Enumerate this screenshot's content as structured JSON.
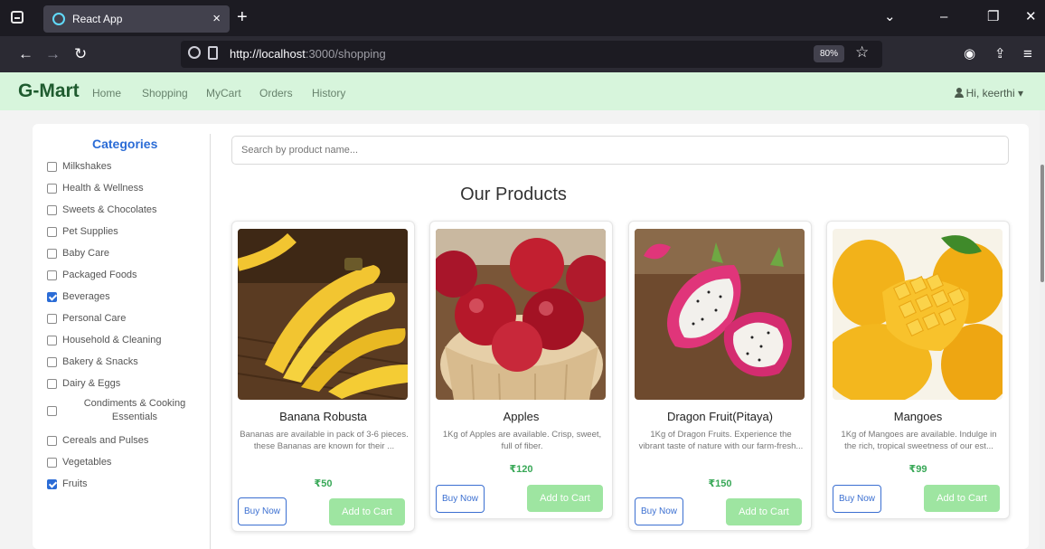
{
  "browser": {
    "tab_title": "React App",
    "tab_close": "×",
    "new_tab": "+",
    "url_host": "http://localhost",
    "url_rest": ":3000/shopping",
    "zoom": "80%",
    "icons": [
      "back-arrow-icon",
      "forward-arrow-icon",
      "reload-icon",
      "shield-icon",
      "page-icon",
      "star-icon",
      "account-icon",
      "extensions-icon",
      "menu-icon"
    ]
  },
  "nav": {
    "brand": "G-Mart",
    "links": [
      "Home",
      "Shopping",
      "MyCart",
      "Orders",
      "History"
    ],
    "user": "Hi, keerthi ▾"
  },
  "sidebar": {
    "title": "Categories",
    "items": [
      {
        "label": "Milkshakes",
        "checked": false
      },
      {
        "label": "Health & Wellness",
        "checked": false
      },
      {
        "label": "Sweets & Chocolates",
        "checked": false
      },
      {
        "label": "Pet Supplies",
        "checked": false
      },
      {
        "label": "Baby Care",
        "checked": false
      },
      {
        "label": "Packaged Foods",
        "checked": false
      },
      {
        "label": "Beverages",
        "checked": true
      },
      {
        "label": "Personal Care",
        "checked": false
      },
      {
        "label": "Household & Cleaning",
        "checked": false
      },
      {
        "label": "Bakery & Snacks",
        "checked": false
      },
      {
        "label": "Dairy & Eggs",
        "checked": false
      },
      {
        "label": "Condiments & Cooking Essentials",
        "checked": false
      },
      {
        "label": "Cereals and Pulses",
        "checked": false
      },
      {
        "label": "Vegetables",
        "checked": false
      },
      {
        "label": "Fruits",
        "checked": true
      }
    ]
  },
  "search": {
    "placeholder": "Search by product name..."
  },
  "main": {
    "title": "Our Products"
  },
  "products": [
    {
      "name": "Banana Robusta",
      "desc": "Bananas are available in pack of 3-6 pieces. these Bananas are known for their ...",
      "price": "₹50",
      "buy": "Buy Now",
      "cart": "Add to Cart"
    },
    {
      "name": "Apples",
      "desc": "1Kg of Apples are available. Crisp, sweet, full of fiber.",
      "price": "₹120",
      "buy": "Buy Now",
      "cart": "Add to Cart"
    },
    {
      "name": "Dragon Fruit(Pitaya)",
      "desc": "1Kg of Dragon Fruits. Experience the vibrant taste of nature with our farm-fresh...",
      "price": "₹150",
      "buy": "Buy Now",
      "cart": "Add to Cart"
    },
    {
      "name": "Mangoes",
      "desc": "1Kg of Mangoes are available. Indulge in the rich, tropical sweetness of our est...",
      "price": "₹99",
      "buy": "Buy Now",
      "cart": "Add to Cart"
    }
  ],
  "colors": {
    "accent": "#2b6cd6",
    "nav_bg": "#d7f5dc",
    "brand": "#1f5b2f",
    "price": "#38a857",
    "cart_button": "#9ee5a1"
  }
}
